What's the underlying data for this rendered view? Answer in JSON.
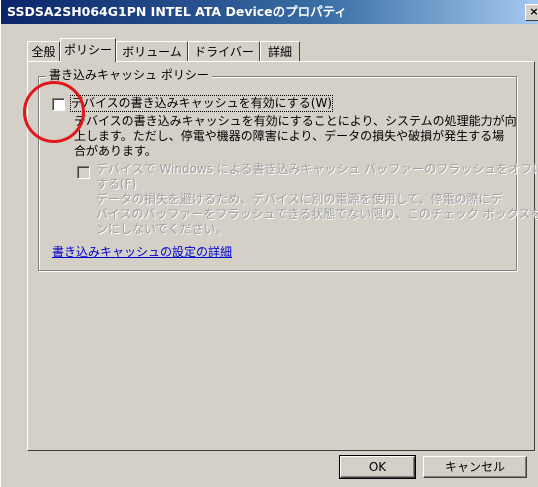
{
  "window": {
    "title": "SSDSA2SH064G1PN INTEL ATA Deviceのプロパティ",
    "close_glyph": "×"
  },
  "tabs": [
    {
      "label": "全般"
    },
    {
      "label": "ポリシー"
    },
    {
      "label": "ボリューム"
    },
    {
      "label": "ドライバー"
    },
    {
      "label": "詳細"
    }
  ],
  "active_tab": "ポリシー",
  "group": {
    "title": "書き込みキャッシュ ポリシー",
    "enable_cache": {
      "label": "デバイスの書き込みキャッシュを有効にする(W)",
      "checked": false,
      "description_lines": [
        "デバイスの書き込みキャッシュを有効にすることにより、システムの処理能力が向",
        "上します。ただし、停電や機器の障害により、データの損失や破損が発生する場",
        "合があります。"
      ]
    },
    "disable_flush": {
      "label_lines": [
        "デバイスで Windows による書き込みキャッシュ バッファーのフラッシュをオフに",
        "する(F)"
      ],
      "checked": false,
      "enabled": false,
      "description_lines": [
        "データの損失を避けるため、デバイスに別の電源を使用して、停電の際にデ",
        "バイスのバッファーをフラッシュできる状態でない限り、このチェック ボックスをオ",
        "ンにしないでください。"
      ]
    },
    "link": "書き込みキャッシュの設定の詳細"
  },
  "buttons": {
    "ok": "OK",
    "cancel": "キャンセル"
  },
  "annotation_color": "#e0181c"
}
